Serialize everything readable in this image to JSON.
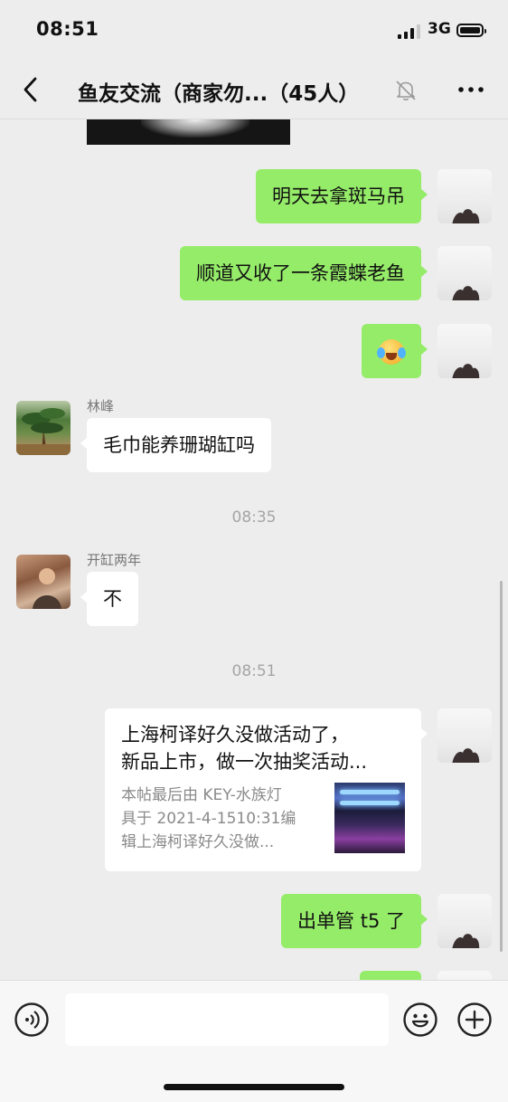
{
  "status_bar": {
    "time": "08:51",
    "network": "3G"
  },
  "nav": {
    "title": "鱼友交流（商家勿...（45人）"
  },
  "messages": {
    "m1": "明天去拿斑马吊",
    "m2": "顺道又收了一条霞蝶老鱼",
    "m3_emoji": "laughing-crying-emoji",
    "m4_sender": "林峰",
    "m4": "毛巾能养珊瑚缸吗",
    "ts1": "08:35",
    "m5_sender": "开缸两年",
    "m5": "不",
    "ts2": "08:51",
    "link": {
      "title_line1": "上海柯译好久没做活动了，",
      "title_line2": "新品上市，做一次抽奖活动...",
      "desc_line1": "本帖最后由 KEY-水族灯",
      "desc_line2": "具于 2021-4-1510:31编",
      "desc_line3": "辑上海柯译好久没做..."
    },
    "m6": "出单管 t5 了"
  },
  "input": {
    "placeholder": ""
  },
  "colors": {
    "my_bubble": "#95ec69",
    "other_bubble": "#ffffff",
    "background": "#ededed"
  }
}
